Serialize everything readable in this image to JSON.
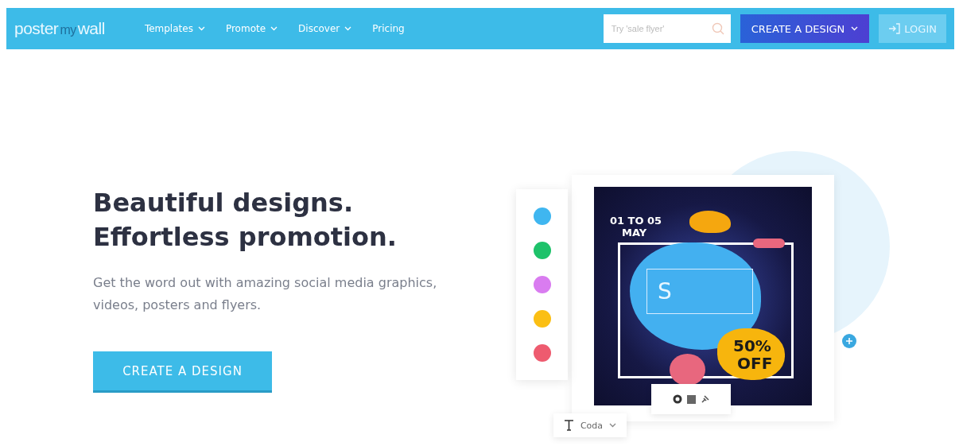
{
  "header": {
    "logo": {
      "part_1": "poster",
      "part_2": "my",
      "part_3": "wall"
    },
    "nav": [
      {
        "label": "Templates",
        "dropdown": true
      },
      {
        "label": "Promote",
        "dropdown": true
      },
      {
        "label": "Discover",
        "dropdown": true
      },
      {
        "label": "Pricing",
        "dropdown": false
      }
    ],
    "search": {
      "placeholder": "Try 'sale flyer'"
    },
    "create_button": "CREATE A DESIGN",
    "login_button": "LOGIN"
  },
  "hero": {
    "title_lines": [
      "Beautiful designs.",
      "Effortless promotion."
    ],
    "subtitle": "Get the word out with amazing social media graphics, videos, posters and flyers.",
    "cta": "CREATE A DESIGN"
  },
  "editor_preview": {
    "swatches": [
      {
        "color": "#3fb6f0"
      },
      {
        "color": "#1ec26a"
      },
      {
        "color": "#d97cf0"
      },
      {
        "color": "#fbbf14"
      },
      {
        "color": "#ee5b6f"
      }
    ],
    "poster": {
      "date_line_1": "01 TO 05",
      "date_line_2": "MAY",
      "letter": "S",
      "discount_line_1": "50%",
      "discount_line_2": "OFF"
    },
    "font_picker": "Coda"
  }
}
